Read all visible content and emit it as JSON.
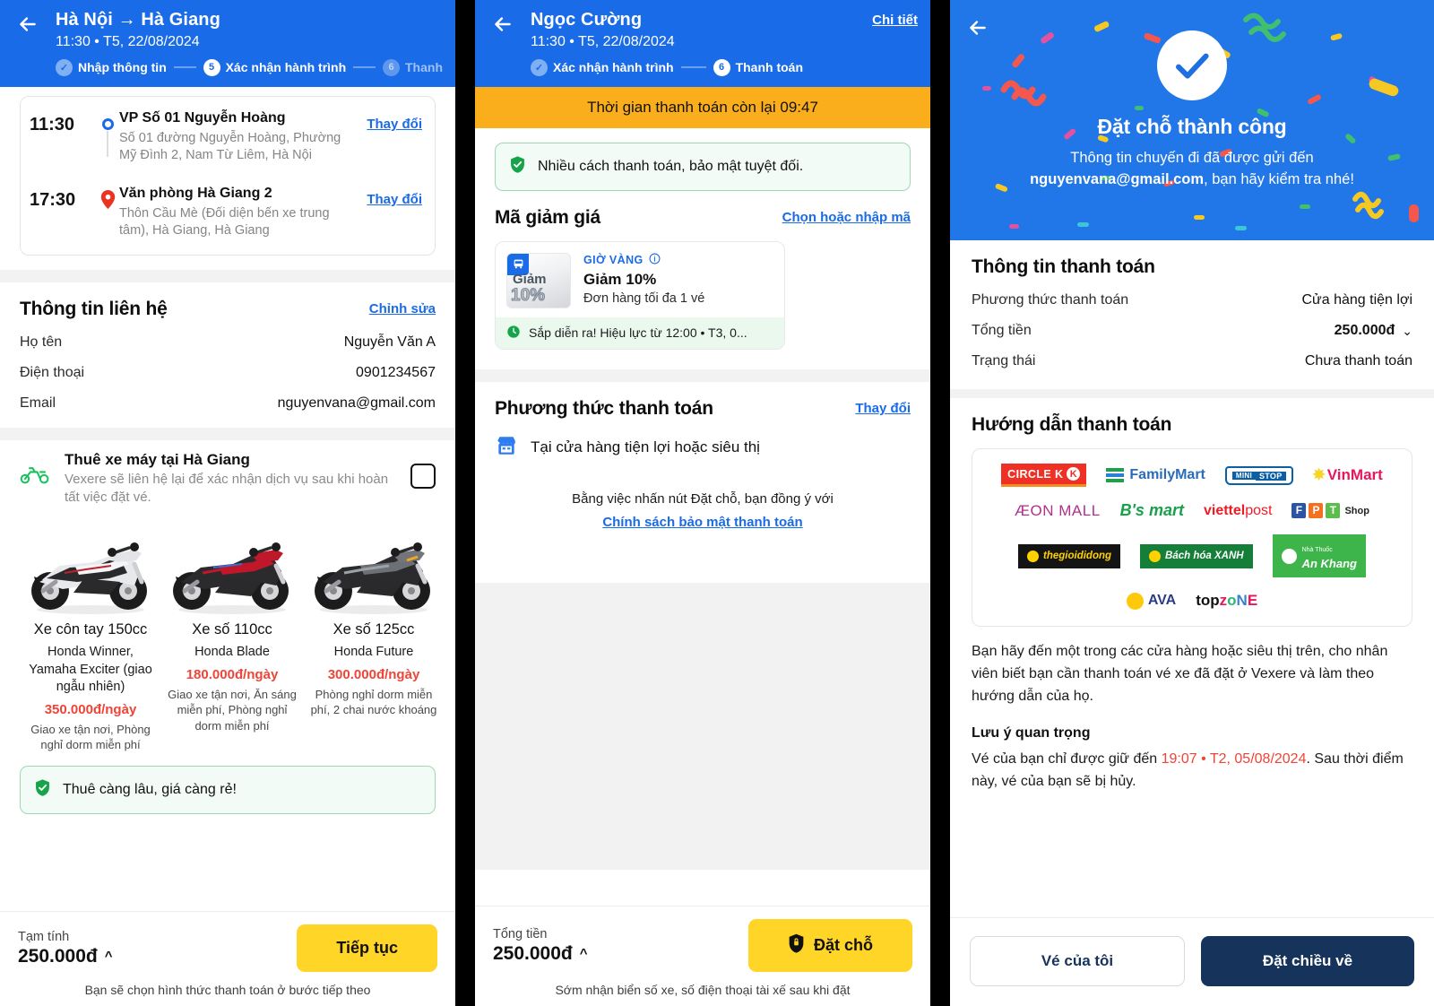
{
  "panel1": {
    "header": {
      "back_icon": "arrow-left-icon",
      "title": "Hà Nội → Hà Giang",
      "subtitle": "11:30 • T5, 22/08/2024",
      "steps": [
        {
          "badge": "✓",
          "label": "Nhập thông tin",
          "state": "done"
        },
        {
          "badge": "5",
          "label": "Xác nhận hành trình",
          "state": "current"
        },
        {
          "badge": "6",
          "label": "Thanh",
          "state": "next"
        }
      ]
    },
    "trip": {
      "legs": [
        {
          "time": "11:30",
          "name": "VP Số 01 Nguyễn Hoàng",
          "address": "Số 01 đường Nguyễn Hoàng, Phường Mỹ Đình 2, Nam Từ Liêm, Hà Nội",
          "change": "Thay đổi",
          "marker": "origin-dot-icon"
        },
        {
          "time": "17:30",
          "name": "Văn phòng Hà Giang 2",
          "address": "Thôn Cầu Mè (Đối diện bến xe trung tâm), Hà Giang, Hà Giang",
          "change": "Thay đổi",
          "marker": "destination-pin-icon"
        }
      ]
    },
    "contact": {
      "title": "Thông tin liên hệ",
      "edit": "Chỉnh sửa",
      "rows": [
        {
          "label": "Họ tên",
          "value": "Nguyễn Văn A"
        },
        {
          "label": "Điện thoại",
          "value": "0901234567"
        },
        {
          "label": "Email",
          "value": "nguyenvana@gmail.com"
        }
      ]
    },
    "rental": {
      "icon": "motorbike-icon",
      "title": "Thuê xe máy tại Hà Giang",
      "desc": "Vexere sẽ liên hệ lại để xác nhận dịch vụ sau khi hoàn tất việc đặt vé.",
      "checkbox_checked": false,
      "bikes": [
        {
          "name": "Xe côn tay 150cc",
          "model": "Honda Winner, Yamaha Exciter (giao ngẫu nhiên)",
          "price": "350.000đ/ngày",
          "perks": "Giao xe tận nơi, Phòng nghỉ dorm miễn phí",
          "color": "#e9e9ec"
        },
        {
          "name": "Xe số 110cc",
          "model": "Honda Blade",
          "price": "180.000đ/ngày",
          "perks": "Giao xe tận nơi, Ăn sáng miễn phí, Phòng nghỉ dorm miễn phí",
          "color": "#c0182a"
        },
        {
          "name": "Xe số 125cc",
          "model": "Honda Future",
          "price": "300.000đ/ngày",
          "perks": "Phòng nghỉ dorm miễn phí, 2 chai nước khoáng",
          "color": "#6d7176"
        }
      ],
      "note": "Thuê càng lâu, giá càng rẻ!"
    },
    "bottom": {
      "sub_label": "Tạm tính",
      "amount": "250.000đ",
      "caret": "︿",
      "cta": "Tiếp tục",
      "foot": "Bạn sẽ chọn hình thức thanh toán ở bước tiếp theo"
    }
  },
  "panel2": {
    "header": {
      "back_icon": "arrow-left-icon",
      "title": "Ngọc Cường",
      "subtitle": "11:30 • T5, 22/08/2024",
      "detail_link": "Chi tiết",
      "steps": [
        {
          "badge": "✓",
          "label": "Xác nhận hành trình",
          "state": "done"
        },
        {
          "badge": "6",
          "label": "Thanh toán",
          "state": "current"
        }
      ]
    },
    "timer": "Thời gian thanh toán còn lại 09:47",
    "secure_note": "Nhiều cách thanh toán, bảo mật tuyệt đối.",
    "voucher": {
      "title": "Mã giảm giá",
      "link": "Chọn hoặc nhập mã",
      "thumb_line1": "Giảm",
      "thumb_line2": "10%",
      "tag": "GIỜ VÀNG",
      "info_icon": "info-icon",
      "name": "Giảm 10%",
      "sub": "Đơn hàng tối đa 1 vé",
      "status": "Sắp diễn ra! Hiệu lực từ 12:00 • T3, 0..."
    },
    "method": {
      "title": "Phương thức thanh toán",
      "change": "Thay đổi",
      "icon": "convenience-store-icon",
      "label": "Tại cửa hàng tiện lợi hoặc siêu thị"
    },
    "agree": {
      "text": "Bằng việc nhấn nút Đặt chỗ, bạn đồng ý với",
      "link": "Chính sách bảo mật thanh toán"
    },
    "bottom": {
      "sub_label": "Tổng tiền",
      "amount": "250.000đ",
      "caret": "︿",
      "cta": "Đặt chỗ",
      "cta_icon": "shield-lock-icon",
      "foot": "Sớm nhận biển số xe, số điện thoại tài xế sau khi đặt"
    }
  },
  "panel3": {
    "header": {
      "back_icon": "arrow-left-icon",
      "check_icon": "check-circle-icon",
      "title": "Đặt chỗ thành công",
      "line1": "Thông tin chuyến đi đã được gửi đến",
      "email": "nguyenvana@gmail.com",
      "line2": ", bạn hãy kiểm tra nhé!"
    },
    "payment_info": {
      "title": "Thông tin thanh toán",
      "rows": [
        {
          "label": "Phương thức thanh toán",
          "value": "Cửa hàng tiện lợi",
          "style": "plain"
        },
        {
          "label": "Tổng tiền",
          "value": "250.000đ",
          "style": "bold",
          "caret": "⌄"
        },
        {
          "label": "Trạng thái",
          "value": "Chưa thanh toán",
          "style": "red"
        }
      ]
    },
    "guide": {
      "title": "Hướng dẫn thanh toán",
      "stores": [
        [
          "CIRCLE K",
          "FamilyMart",
          "MINI STOP",
          "VinMart"
        ],
        [
          "ÆON MALL",
          "B's mart",
          "viettel post",
          "FPT Shop"
        ],
        [
          "thegioididong",
          "Bách hóa XANH",
          "An Khang"
        ],
        [
          "AVA",
          "topzone"
        ]
      ],
      "paragraph": "Bạn hãy đến một trong các cửa hàng hoặc siêu thị trên, cho nhân viên biết bạn cần thanh toán vé xe đã đặt ở Vexere và làm theo hướng dẫn của họ.",
      "note_title": "Lưu ý quan trọng",
      "note_pre": "Vé của bạn chỉ được giữ đến ",
      "note_time": "19:07 • T2, 05/08/2024",
      "note_post": ". Sau thời điểm này, vé của bạn sẽ bị hủy."
    },
    "bottom": {
      "secondary": "Vé của tôi",
      "primary": "Đặt chiều về"
    }
  },
  "colors": {
    "brand_blue": "#1A6BE8",
    "header_blue3": "#2176E8",
    "yellow": "#FFD527",
    "amber": "#FAAE1B",
    "red": "#F04437",
    "navy": "#16335C",
    "green": "#1DA955"
  }
}
